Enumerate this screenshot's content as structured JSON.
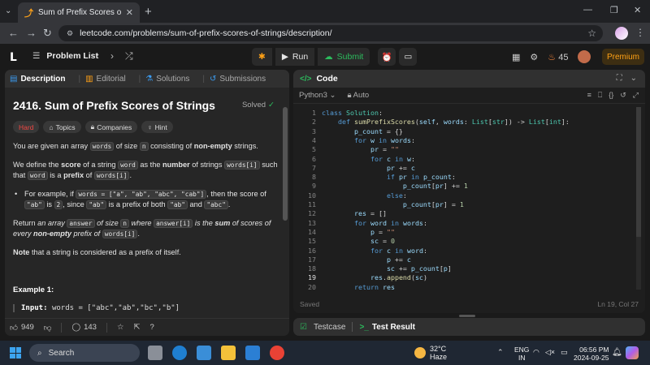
{
  "browser": {
    "tab_title": "Sum of Prefix Scores of Strings",
    "url": "leetcode.com/problems/sum-of-prefix-scores-of-strings/description/"
  },
  "header": {
    "problem_list": "Problem List",
    "run": "Run",
    "submit": "Submit",
    "streak": "45",
    "premium": "Premium"
  },
  "left": {
    "tabs": [
      "Description",
      "Editorial",
      "Solutions",
      "Submissions"
    ],
    "title": "2416. Sum of Prefix Scores of Strings",
    "status": "Solved",
    "chips": [
      "Hard",
      "Topics",
      "Companies",
      "Hint"
    ],
    "p1": {
      "a": "You are given an array ",
      "c1": "words",
      "b": " of size ",
      "c2": "n",
      "d": " consisting of ",
      "e": "non-empty",
      "f": " strings."
    },
    "p2": {
      "a": "We define the ",
      "b": "score",
      "c": " of a string ",
      "c1": "word",
      "d": " as the ",
      "e": "number",
      "f": " of strings ",
      "c2": "words[i]",
      "g": " such that ",
      "c3": "word",
      "h": " is a ",
      "i": "prefix",
      "j": " of ",
      "c4": "words[i]",
      "k": "."
    },
    "bullet": {
      "a": "For example, if ",
      "c1": "words = [\"a\", \"ab\", \"abc\", \"cab\"]",
      "b": ", then the score of ",
      "c2": "\"ab\"",
      "c": " is ",
      "c3": "2",
      "d": ", since ",
      "c4": "\"ab\"",
      "e": " is a prefix of both ",
      "c5": "\"ab\"",
      "f": " and ",
      "c6": "\"abc\"",
      "g": "."
    },
    "p3": {
      "a": "Return ",
      "b": "an array ",
      "c1": "answer",
      "c": " of size ",
      "c2": "n",
      "d": " where ",
      "c3": "answer[i]",
      "e": " is the ",
      "f": "sum",
      "g": " of scores of every ",
      "h": "non-empty",
      "i": " prefix of ",
      "c4": "words[i]",
      "j": "."
    },
    "p4": {
      "a": "Note",
      "b": " that a string is considered as a prefix of itself."
    },
    "example_title": "Example 1:",
    "example_input_label": "Input:",
    "example_input": "words = [\"abc\",\"ab\",\"bc\",\"b\"]",
    "likes": "949",
    "comments": "143"
  },
  "code": {
    "panel_title": "Code",
    "language": "Python3",
    "auto": "Auto",
    "saved": "Saved",
    "cursor": "Ln 19, Col 27",
    "active_line": 19,
    "lines": [
      "class Solution:",
      "    def sumPrefixScores(self, words: List[str]) -> List[int]:",
      "        p_count = {}",
      "        for w in words:",
      "            pr = \"\"",
      "            for c in w:",
      "                pr += c",
      "                if pr in p_count:",
      "                    p_count[pr] += 1",
      "                else:",
      "                    p_count[pr] = 1",
      "        res = []",
      "        for word in words:",
      "            p = \"\"",
      "            sc = 0",
      "            for c in word:",
      "                p += c",
      "                sc += p_count[p]",
      "            res.append(sc)",
      "        return res"
    ]
  },
  "test": {
    "testcase": "Testcase",
    "result": "Test Result"
  },
  "taskbar": {
    "search": "Search",
    "temp": "32°C",
    "weather": "Haze",
    "lang1": "ENG",
    "lang2": "IN",
    "time": "06:56 PM",
    "date": "2024-09-25"
  }
}
